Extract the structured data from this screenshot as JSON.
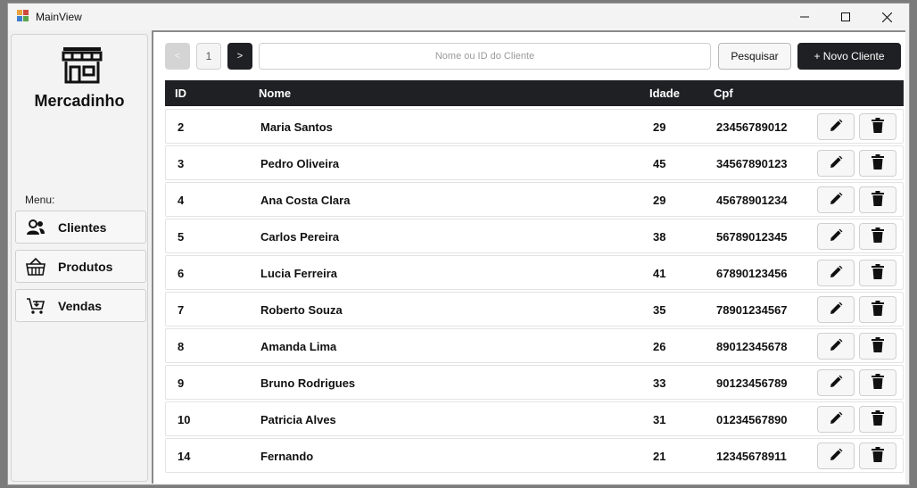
{
  "window": {
    "title": "MainView"
  },
  "sidebar": {
    "brand": "Mercadinho",
    "menu_label": "Menu:",
    "items": [
      {
        "label": "Clientes",
        "icon": "users-icon"
      },
      {
        "label": "Produtos",
        "icon": "basket-icon"
      },
      {
        "label": "Vendas",
        "icon": "cart-icon"
      }
    ]
  },
  "toolbar": {
    "prev_label": "<",
    "page": "1",
    "next_label": ">",
    "search_placeholder": "Nome ou ID do Cliente",
    "search_label": "Pesquisar",
    "new_label": "+ Novo Cliente"
  },
  "table": {
    "columns": [
      "ID",
      "Nome",
      "Idade",
      "Cpf"
    ],
    "rows": [
      {
        "id": "2",
        "nome": "Maria Santos",
        "idade": "29",
        "cpf": "23456789012"
      },
      {
        "id": "3",
        "nome": "Pedro Oliveira",
        "idade": "45",
        "cpf": "34567890123"
      },
      {
        "id": "4",
        "nome": "Ana Costa Clara",
        "idade": "29",
        "cpf": "45678901234"
      },
      {
        "id": "5",
        "nome": "Carlos Pereira",
        "idade": "38",
        "cpf": "56789012345"
      },
      {
        "id": "6",
        "nome": "Lucia Ferreira",
        "idade": "41",
        "cpf": "67890123456"
      },
      {
        "id": "7",
        "nome": "Roberto Souza",
        "idade": "35",
        "cpf": "78901234567"
      },
      {
        "id": "8",
        "nome": "Amanda Lima",
        "idade": "26",
        "cpf": "89012345678"
      },
      {
        "id": "9",
        "nome": "Bruno Rodrigues",
        "idade": "33",
        "cpf": "90123456789"
      },
      {
        "id": "10",
        "nome": "Patricia Alves",
        "idade": "31",
        "cpf": "01234567890"
      },
      {
        "id": "14",
        "nome": "Fernando",
        "idade": "21",
        "cpf": "12345678911"
      }
    ]
  },
  "colors": {
    "dark": "#1f2023",
    "row_border": "#e3e3e3"
  }
}
